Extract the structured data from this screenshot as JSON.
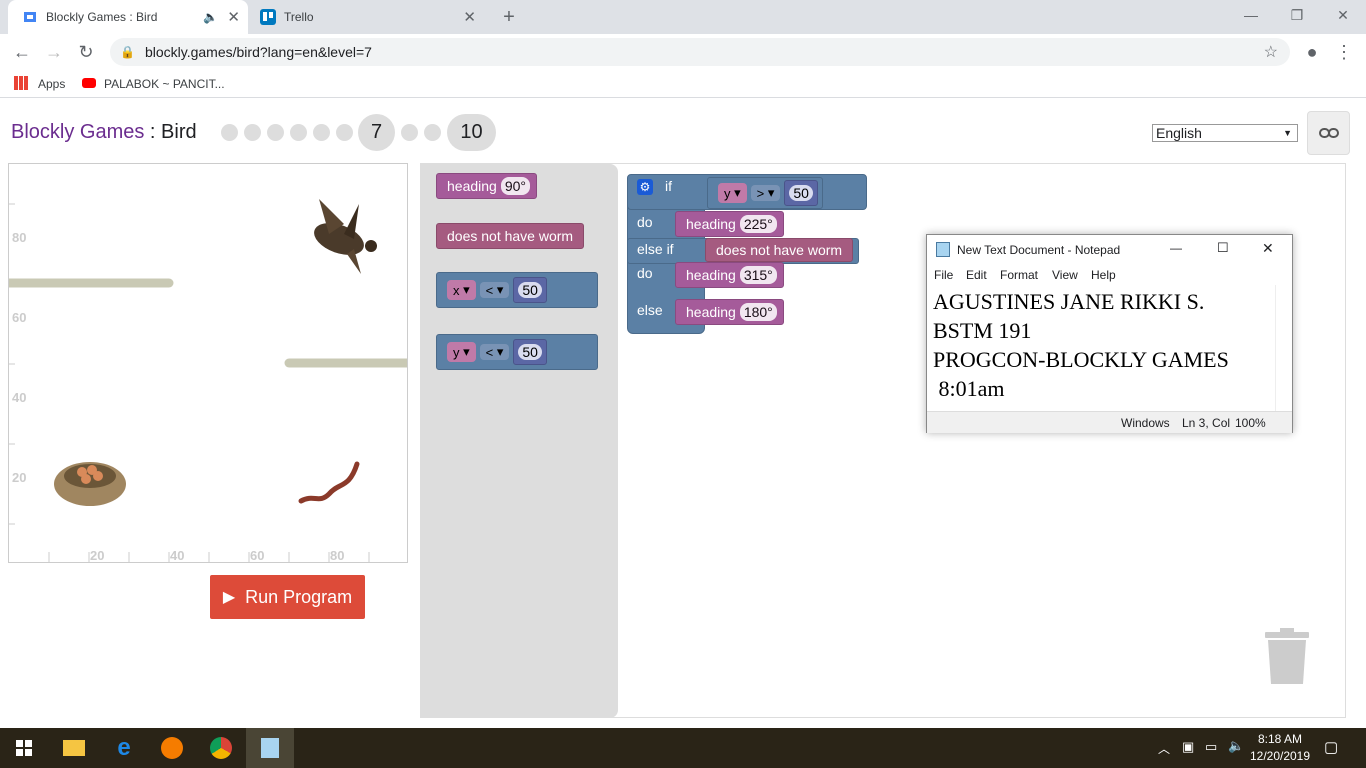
{
  "browser": {
    "tabs": [
      {
        "title": "Blockly Games : Bird",
        "active": true
      },
      {
        "title": "Trello",
        "active": false
      }
    ],
    "url": "blockly.games/bird?lang=en&level=7",
    "bookmarks": [
      "Apps",
      "PALABOK ~ PANCIT..."
    ]
  },
  "page": {
    "brand": "Blockly Games",
    "separator": " : ",
    "game": "Bird",
    "current_level": "7",
    "last_level": "10",
    "language": "English",
    "run_button": "Run Program",
    "axis_y": [
      "80",
      "60",
      "40",
      "20"
    ],
    "axis_x": [
      "20",
      "40",
      "60",
      "80"
    ]
  },
  "toolbox": {
    "heading_label": "heading",
    "heading_value": "90°",
    "no_worm": "does not have worm",
    "cmp1_var": "x",
    "cmp1_op": "<",
    "cmp1_val": "50",
    "cmp2_var": "y",
    "cmp2_op": "<",
    "cmp2_val": "50"
  },
  "program": {
    "if_label": "if",
    "cond_var": "y",
    "cond_op": ">",
    "cond_val": "50",
    "do1_label": "do",
    "do1_heading": "heading",
    "do1_value": "225°",
    "elseif_label": "else if",
    "elseif_cond": "does not have worm",
    "do2_label": "do",
    "do2_heading": "heading",
    "do2_value": "315°",
    "else_label": "else",
    "else_heading": "heading",
    "else_value": "180°"
  },
  "notepad": {
    "title": "New Text Document - Notepad",
    "menu": [
      "File",
      "Edit",
      "Format",
      "View",
      "Help"
    ],
    "lines": [
      "AGUSTINES JANE RIKKI S.",
      "BSTM 191",
      "PROGCON-BLOCKLY GAMES",
      " 8:01am"
    ],
    "status_eol": "Windows",
    "status_pos": "Ln 3, Col",
    "status_zoom": "100%"
  },
  "taskbar": {
    "time": "8:18 AM",
    "date": "12/20/2019"
  }
}
